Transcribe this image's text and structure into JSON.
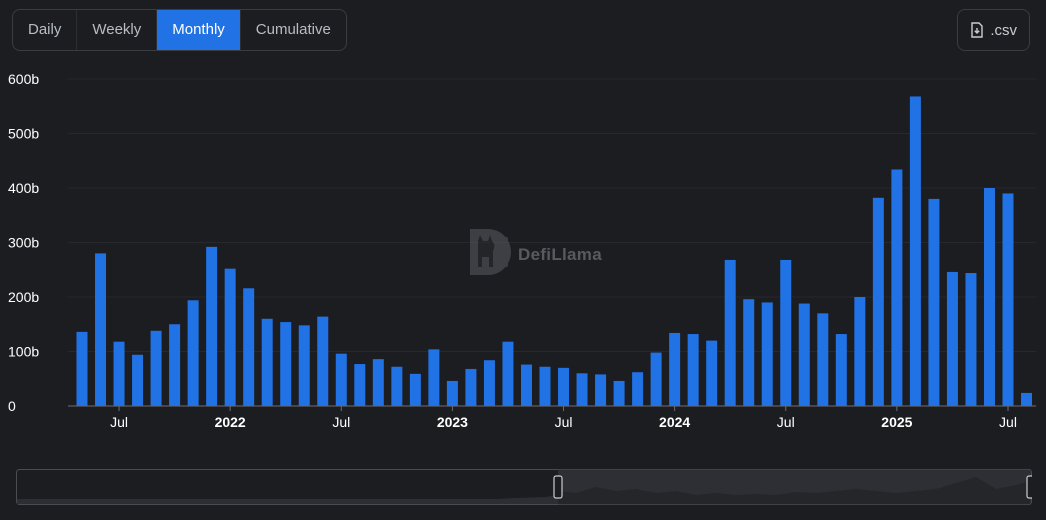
{
  "toolbar": {
    "tabs": [
      {
        "label": "Daily",
        "active": false
      },
      {
        "label": "Weekly",
        "active": false
      },
      {
        "label": "Monthly",
        "active": true
      },
      {
        "label": "Cumulative",
        "active": false
      }
    ],
    "csv_label": ".csv",
    "csv_icon": "download-file-icon"
  },
  "watermark": {
    "text": "DefiLlama",
    "icon": "llama-logo-icon"
  },
  "colors": {
    "bar": "#2172e5",
    "background": "#1c1d21",
    "accent": "#2172e5"
  },
  "chart_data": {
    "type": "bar",
    "title": "",
    "xlabel": "",
    "ylabel": "",
    "ylim": [
      0,
      600
    ],
    "y_ticks": [
      0,
      100,
      200,
      300,
      400,
      500,
      600
    ],
    "y_tick_labels": [
      "0",
      "100b",
      "200b",
      "300b",
      "400b",
      "500b",
      "600b"
    ],
    "grid": true,
    "categories": [
      "2021-05",
      "2021-06",
      "2021-07",
      "2021-08",
      "2021-09",
      "2021-10",
      "2021-11",
      "2021-12",
      "2022-01",
      "2022-02",
      "2022-03",
      "2022-04",
      "2022-05",
      "2022-06",
      "2022-07",
      "2022-08",
      "2022-09",
      "2022-10",
      "2022-11",
      "2022-12",
      "2023-01",
      "2023-02",
      "2023-03",
      "2023-04",
      "2023-05",
      "2023-06",
      "2023-07",
      "2023-08",
      "2023-09",
      "2023-10",
      "2023-11",
      "2023-12",
      "2024-01",
      "2024-02",
      "2024-03",
      "2024-04",
      "2024-05",
      "2024-06",
      "2024-07",
      "2024-08",
      "2024-09",
      "2024-10",
      "2024-11",
      "2024-12",
      "2025-01",
      "2025-02",
      "2025-03",
      "2025-04",
      "2025-05",
      "2025-06",
      "2025-07"
    ],
    "values": [
      136,
      280,
      118,
      94,
      138,
      150,
      194,
      292,
      252,
      216,
      160,
      154,
      148,
      164,
      96,
      77,
      86,
      72,
      59,
      104,
      46,
      68,
      84,
      118,
      76,
      72,
      70,
      60,
      58,
      46,
      62,
      98,
      134,
      132,
      120,
      268,
      196,
      190,
      268,
      188,
      170,
      132,
      200,
      382,
      434,
      568,
      380,
      246,
      244,
      400,
      390,
      24
    ],
    "x_tick_labels": [
      {
        "label": "Jul",
        "category": "2021-07",
        "year": false
      },
      {
        "label": "2022",
        "category": "2022-01",
        "year": true
      },
      {
        "label": "Jul",
        "category": "2022-07",
        "year": false
      },
      {
        "label": "2023",
        "category": "2023-01",
        "year": true
      },
      {
        "label": "Jul",
        "category": "2023-07",
        "year": false
      },
      {
        "label": "2024",
        "category": "2024-01",
        "year": true
      },
      {
        "label": "Jul",
        "category": "2024-07",
        "year": false
      },
      {
        "label": "2025",
        "category": "2025-01",
        "year": true
      },
      {
        "label": "Jul",
        "category": "2025-07",
        "year": false
      }
    ]
  }
}
